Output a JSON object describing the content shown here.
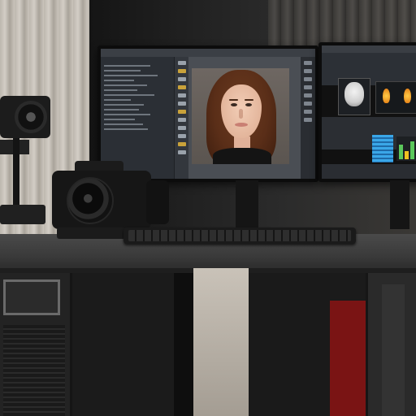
{
  "scene": {
    "description_type": "photo",
    "palette": {
      "curtain": "#c9c3ba",
      "desk": "#3f3f3f",
      "screen_ui": "#2b2f35",
      "accent_blue": "#3aa7e8",
      "accent_orange": "#f0a020",
      "red_box": "#7a1414"
    }
  },
  "main_monitor": {
    "menu_items": [
      "",
      "",
      "",
      "",
      "",
      ""
    ]
  },
  "icons": {
    "camera": "camera-icon",
    "keyboard": "keyboard-icon",
    "monitor": "monitor-icon"
  }
}
